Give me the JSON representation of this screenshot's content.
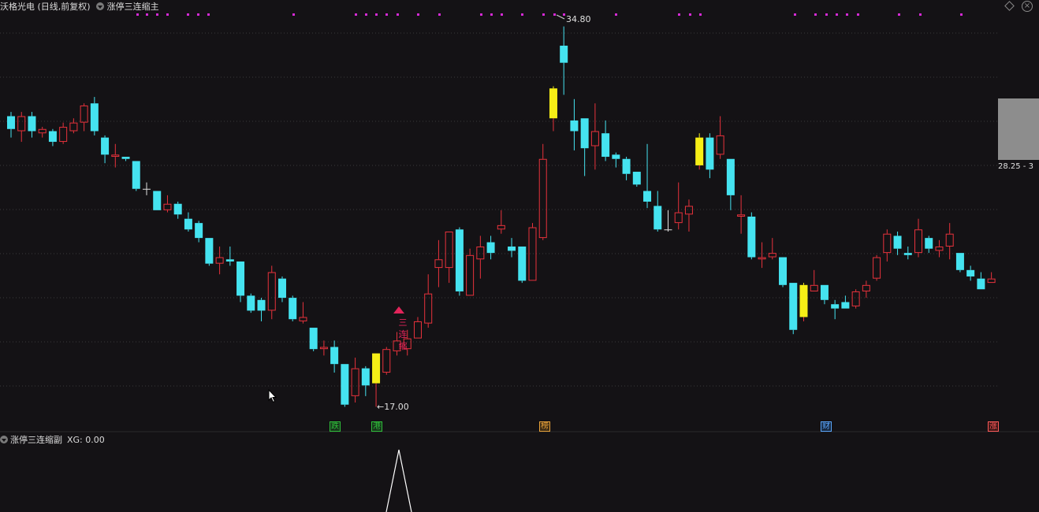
{
  "header": {
    "stock_title": "沃格光电 (日线,前复权)",
    "indicator_name": "涨停三连缩主"
  },
  "sub_panel": {
    "indicator_name": "涨停三连缩副",
    "xg_text": "XG: 0.00"
  },
  "annotations": {
    "high_label": "34.80",
    "low_label": "17.00",
    "price_readout": "28.25 - 3",
    "signal_text": "三连缩"
  },
  "event_tags": [
    {
      "text": "跌",
      "color": "#2fbf3a",
      "bg": "#17351b"
    },
    {
      "text": "港",
      "color": "#2fbf3a",
      "bg": "#17351b"
    },
    {
      "text": "榜",
      "color": "#e8a23a",
      "bg": "#3a2a14"
    },
    {
      "text": "财",
      "color": "#5aa7ff",
      "bg": "#16263c"
    },
    {
      "text": "涨",
      "color": "#ff5a5a",
      "bg": "#3c1616"
    }
  ],
  "colors": {
    "up": "#e8323c",
    "down": "#45e3f0",
    "limit_up": "#f6ee16",
    "marker": "#d52ad5",
    "grid": "#3a3a3a",
    "background": "#141215"
  },
  "chart_data": {
    "type": "candlestick",
    "price_range": [
      16.5,
      35.3
    ],
    "high": 34.8,
    "low": 17.0,
    "candles": [
      {
        "o": 30.0,
        "c": 30.6,
        "h": 30.8,
        "l": 29.6,
        "t": "down"
      },
      {
        "o": 29.9,
        "c": 30.6,
        "h": 30.8,
        "l": 29.4,
        "t": "up"
      },
      {
        "o": 30.6,
        "c": 29.9,
        "h": 30.8,
        "l": 29.6,
        "t": "down"
      },
      {
        "o": 29.8,
        "c": 30.0,
        "h": 30.1,
        "l": 29.6,
        "t": "up"
      },
      {
        "o": 29.9,
        "c": 29.4,
        "h": 30.0,
        "l": 29.2,
        "t": "down"
      },
      {
        "o": 29.4,
        "c": 30.1,
        "h": 30.3,
        "l": 29.3,
        "t": "up"
      },
      {
        "o": 29.9,
        "c": 30.3,
        "h": 30.5,
        "l": 29.8,
        "t": "up"
      },
      {
        "o": 30.3,
        "c": 31.1,
        "h": 31.2,
        "l": 29.9,
        "t": "up"
      },
      {
        "o": 31.2,
        "c": 29.9,
        "h": 31.5,
        "l": 29.7,
        "t": "down"
      },
      {
        "o": 29.6,
        "c": 28.8,
        "h": 29.7,
        "l": 28.4,
        "t": "down"
      },
      {
        "o": 28.7,
        "c": 28.8,
        "h": 29.3,
        "l": 28.2,
        "t": "up"
      },
      {
        "o": 28.7,
        "c": 28.6,
        "h": 28.7,
        "l": 28.5,
        "t": "down"
      },
      {
        "o": 28.5,
        "c": 27.2,
        "h": 28.5,
        "l": 27.1,
        "t": "down"
      },
      {
        "o": 27.2,
        "c": 27.2,
        "h": 27.5,
        "l": 26.9,
        "t": "flat"
      },
      {
        "o": 27.1,
        "c": 26.2,
        "h": 27.1,
        "l": 26.2,
        "t": "down"
      },
      {
        "o": 26.2,
        "c": 26.5,
        "h": 26.9,
        "l": 26.1,
        "t": "up"
      },
      {
        "o": 26.5,
        "c": 26.0,
        "h": 26.6,
        "l": 25.8,
        "t": "down"
      },
      {
        "o": 25.8,
        "c": 25.3,
        "h": 26.1,
        "l": 25.2,
        "t": "down"
      },
      {
        "o": 25.6,
        "c": 24.9,
        "h": 25.7,
        "l": 24.7,
        "t": "down"
      },
      {
        "o": 24.9,
        "c": 23.7,
        "h": 24.9,
        "l": 23.6,
        "t": "down"
      },
      {
        "o": 23.7,
        "c": 24.0,
        "h": 24.5,
        "l": 23.2,
        "t": "up"
      },
      {
        "o": 23.9,
        "c": 23.8,
        "h": 24.5,
        "l": 23.6,
        "t": "down"
      },
      {
        "o": 23.8,
        "c": 22.2,
        "h": 23.8,
        "l": 21.9,
        "t": "down"
      },
      {
        "o": 22.2,
        "c": 21.5,
        "h": 22.3,
        "l": 21.4,
        "t": "down"
      },
      {
        "o": 22.0,
        "c": 21.5,
        "h": 22.1,
        "l": 21.0,
        "t": "down"
      },
      {
        "o": 21.5,
        "c": 23.3,
        "h": 23.6,
        "l": 21.1,
        "t": "up"
      },
      {
        "o": 23.0,
        "c": 22.1,
        "h": 23.1,
        "l": 21.9,
        "t": "down"
      },
      {
        "o": 22.1,
        "c": 21.1,
        "h": 22.2,
        "l": 21.0,
        "t": "down"
      },
      {
        "o": 21.0,
        "c": 21.2,
        "h": 21.9,
        "l": 20.9,
        "t": "up"
      },
      {
        "o": 20.7,
        "c": 19.7,
        "h": 20.7,
        "l": 19.6,
        "t": "down"
      },
      {
        "o": 19.7,
        "c": 19.8,
        "h": 20.1,
        "l": 19.4,
        "t": "up"
      },
      {
        "o": 19.8,
        "c": 19.0,
        "h": 20.1,
        "l": 18.6,
        "t": "down"
      },
      {
        "o": 19.0,
        "c": 17.1,
        "h": 19.0,
        "l": 17.0,
        "t": "down"
      },
      {
        "o": 17.5,
        "c": 18.8,
        "h": 19.3,
        "l": 17.2,
        "t": "up"
      },
      {
        "o": 18.8,
        "c": 18.0,
        "h": 18.9,
        "l": 17.5,
        "t": "down"
      },
      {
        "o": 18.1,
        "c": 19.5,
        "h": 19.5,
        "l": 17.0,
        "t": "limit"
      },
      {
        "o": 18.6,
        "c": 19.7,
        "h": 19.8,
        "l": 18.5,
        "t": "up"
      },
      {
        "o": 19.6,
        "c": 20.1,
        "h": 20.5,
        "l": 19.4,
        "t": "up"
      },
      {
        "o": 19.7,
        "c": 20.2,
        "h": 20.6,
        "l": 19.4,
        "t": "up"
      },
      {
        "o": 20.2,
        "c": 21.0,
        "h": 21.2,
        "l": 20.2,
        "t": "up"
      },
      {
        "o": 20.9,
        "c": 22.3,
        "h": 23.2,
        "l": 20.7,
        "t": "up"
      },
      {
        "o": 23.5,
        "c": 23.9,
        "h": 24.8,
        "l": 22.6,
        "t": "up"
      },
      {
        "o": 23.5,
        "c": 25.2,
        "h": 25.2,
        "l": 22.8,
        "t": "up"
      },
      {
        "o": 25.3,
        "c": 22.4,
        "h": 25.4,
        "l": 22.2,
        "t": "down"
      },
      {
        "o": 22.2,
        "c": 24.1,
        "h": 24.4,
        "l": 22.2,
        "t": "up"
      },
      {
        "o": 23.9,
        "c": 24.5,
        "h": 25.0,
        "l": 23.0,
        "t": "up"
      },
      {
        "o": 24.7,
        "c": 24.2,
        "h": 25.0,
        "l": 23.9,
        "t": "down"
      },
      {
        "o": 25.3,
        "c": 25.5,
        "h": 26.2,
        "l": 25.1,
        "t": "up"
      },
      {
        "o": 24.5,
        "c": 24.3,
        "h": 24.9,
        "l": 24.0,
        "t": "down"
      },
      {
        "o": 24.5,
        "c": 22.9,
        "h": 24.5,
        "l": 22.8,
        "t": "down"
      },
      {
        "o": 22.9,
        "c": 25.4,
        "h": 25.6,
        "l": 22.9,
        "t": "up"
      },
      {
        "o": 24.9,
        "c": 28.6,
        "h": 29.3,
        "l": 24.8,
        "t": "up"
      },
      {
        "o": 30.5,
        "c": 31.9,
        "h": 32.0,
        "l": 29.9,
        "t": "limit"
      },
      {
        "o": 33.9,
        "c": 33.1,
        "h": 34.8,
        "l": 31.6,
        "t": "down"
      },
      {
        "o": 30.4,
        "c": 29.9,
        "h": 31.4,
        "l": 29.0,
        "t": "down"
      },
      {
        "o": 30.5,
        "c": 29.1,
        "h": 30.5,
        "l": 27.8,
        "t": "down"
      },
      {
        "o": 29.2,
        "c": 29.9,
        "h": 31.2,
        "l": 28.1,
        "t": "up"
      },
      {
        "o": 29.8,
        "c": 28.7,
        "h": 30.4,
        "l": 28.5,
        "t": "down"
      },
      {
        "o": 28.8,
        "c": 28.6,
        "h": 28.9,
        "l": 28.2,
        "t": "down"
      },
      {
        "o": 28.6,
        "c": 27.9,
        "h": 28.7,
        "l": 27.6,
        "t": "down"
      },
      {
        "o": 28.0,
        "c": 27.4,
        "h": 28.0,
        "l": 27.3,
        "t": "down"
      },
      {
        "o": 27.1,
        "c": 26.6,
        "h": 29.3,
        "l": 26.3,
        "t": "down"
      },
      {
        "o": 26.4,
        "c": 25.3,
        "h": 27.1,
        "l": 25.2,
        "t": "down"
      },
      {
        "o": 25.3,
        "c": 25.3,
        "h": 26.2,
        "l": 25.2,
        "t": "flat"
      },
      {
        "o": 25.6,
        "c": 26.1,
        "h": 27.5,
        "l": 25.3,
        "t": "up"
      },
      {
        "o": 26.0,
        "c": 26.4,
        "h": 26.7,
        "l": 25.2,
        "t": "up"
      },
      {
        "o": 28.3,
        "c": 29.6,
        "h": 29.8,
        "l": 28.1,
        "t": "limit"
      },
      {
        "o": 29.6,
        "c": 28.1,
        "h": 29.8,
        "l": 27.7,
        "t": "down"
      },
      {
        "o": 28.8,
        "c": 29.7,
        "h": 30.6,
        "l": 28.6,
        "t": "up"
      },
      {
        "o": 28.6,
        "c": 26.9,
        "h": 28.6,
        "l": 26.2,
        "t": "down"
      },
      {
        "o": 25.9,
        "c": 26.0,
        "h": 26.9,
        "l": 25.1,
        "t": "up"
      },
      {
        "o": 25.9,
        "c": 24.0,
        "h": 26.1,
        "l": 23.9,
        "t": "down"
      },
      {
        "o": 23.9,
        "c": 24.0,
        "h": 24.7,
        "l": 23.5,
        "t": "up"
      },
      {
        "o": 24.0,
        "c": 24.2,
        "h": 24.9,
        "l": 23.9,
        "t": "up"
      },
      {
        "o": 24.0,
        "c": 22.7,
        "h": 24.0,
        "l": 22.6,
        "t": "down"
      },
      {
        "o": 22.8,
        "c": 20.6,
        "h": 22.8,
        "l": 20.4,
        "t": "down"
      },
      {
        "o": 21.2,
        "c": 22.7,
        "h": 22.8,
        "l": 21.0,
        "t": "limit"
      },
      {
        "o": 22.4,
        "c": 22.7,
        "h": 23.4,
        "l": 22.4,
        "t": "up"
      },
      {
        "o": 22.7,
        "c": 22.0,
        "h": 22.7,
        "l": 21.8,
        "t": "down"
      },
      {
        "o": 21.8,
        "c": 21.6,
        "h": 22.0,
        "l": 21.1,
        "t": "down"
      },
      {
        "o": 21.6,
        "c": 21.9,
        "h": 22.2,
        "l": 21.6,
        "t": "down"
      },
      {
        "o": 21.7,
        "c": 22.4,
        "h": 22.5,
        "l": 21.6,
        "t": "up"
      },
      {
        "o": 22.4,
        "c": 22.7,
        "h": 22.9,
        "l": 22.1,
        "t": "up"
      },
      {
        "o": 23.0,
        "c": 24.0,
        "h": 24.1,
        "l": 22.9,
        "t": "up"
      },
      {
        "o": 24.2,
        "c": 25.1,
        "h": 25.3,
        "l": 23.8,
        "t": "up"
      },
      {
        "o": 25.0,
        "c": 24.4,
        "h": 25.2,
        "l": 24.1,
        "t": "down"
      },
      {
        "o": 24.2,
        "c": 24.1,
        "h": 24.5,
        "l": 23.9,
        "t": "down"
      },
      {
        "o": 24.2,
        "c": 25.3,
        "h": 25.8,
        "l": 24.0,
        "t": "up"
      },
      {
        "o": 24.9,
        "c": 24.4,
        "h": 25.0,
        "l": 24.2,
        "t": "down"
      },
      {
        "o": 24.3,
        "c": 24.5,
        "h": 24.8,
        "l": 24.0,
        "t": "up"
      },
      {
        "o": 24.5,
        "c": 25.1,
        "h": 25.6,
        "l": 23.9,
        "t": "up"
      },
      {
        "o": 24.2,
        "c": 23.4,
        "h": 24.2,
        "l": 23.3,
        "t": "down"
      },
      {
        "o": 23.4,
        "c": 23.1,
        "h": 23.6,
        "l": 22.9,
        "t": "down"
      },
      {
        "o": 23.0,
        "c": 22.5,
        "h": 23.3,
        "l": 22.5,
        "t": "down"
      },
      {
        "o": 22.8,
        "c": 23.0,
        "h": 23.3,
        "l": 22.8,
        "t": "up"
      }
    ],
    "sub_series": {
      "name": "XG",
      "value": 0.0
    }
  }
}
